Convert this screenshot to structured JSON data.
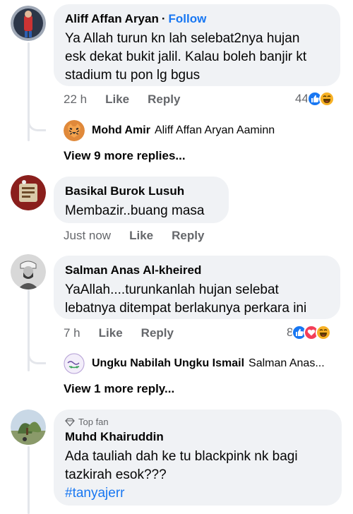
{
  "comments": [
    {
      "author": "Aliff Affan Aryan",
      "follow": "Follow",
      "separator": "·",
      "lines": [
        "Ya Allah turun kn lah selebat2nya hujan",
        "esk dekat bukit jalil. Kalau boleh banjir kt",
        "stadium tu pon lg bgus"
      ],
      "time": "22 h",
      "like": "Like",
      "reply": "Reply",
      "reaction_count": "44",
      "reactions": [
        "like-icon",
        "haha-icon"
      ],
      "reply_preview": {
        "author": "Mohd Amir",
        "text": "Aliff Affan Aryan Aaminn"
      },
      "more_replies": "View 9 more replies..."
    },
    {
      "author": "Basikal Burok Lusuh",
      "lines": [
        "Membazir..buang masa"
      ],
      "time": "Just now",
      "like": "Like",
      "reply": "Reply"
    },
    {
      "author": "Salman Anas Al-kheired",
      "lines": [
        "YaAllah....turunkanlah hujan selebat",
        "lebatnya ditempat berlakunya perkara ini"
      ],
      "time": "7 h",
      "like": "Like",
      "reply": "Reply",
      "reaction_count": "8",
      "reactions": [
        "like-icon",
        "love-icon",
        "haha-icon"
      ],
      "reply_preview": {
        "author": "Ungku Nabilah Ungku Ismail",
        "text": "Salman Anas..."
      },
      "more_replies": "View 1 more reply..."
    },
    {
      "badge": "Top fan",
      "author": "Muhd Khairuddin",
      "lines": [
        "Ada tauliah dah ke tu blackpink nk bagi",
        "tazkirah esok???"
      ],
      "hashtag": "#tanyajerr"
    }
  ],
  "colors": {
    "bubble": "#f0f2f5",
    "meta": "#65676b",
    "link": "#1877f2",
    "like": "#1877f2",
    "love": "#f33e58",
    "haha": "#f7b125"
  }
}
